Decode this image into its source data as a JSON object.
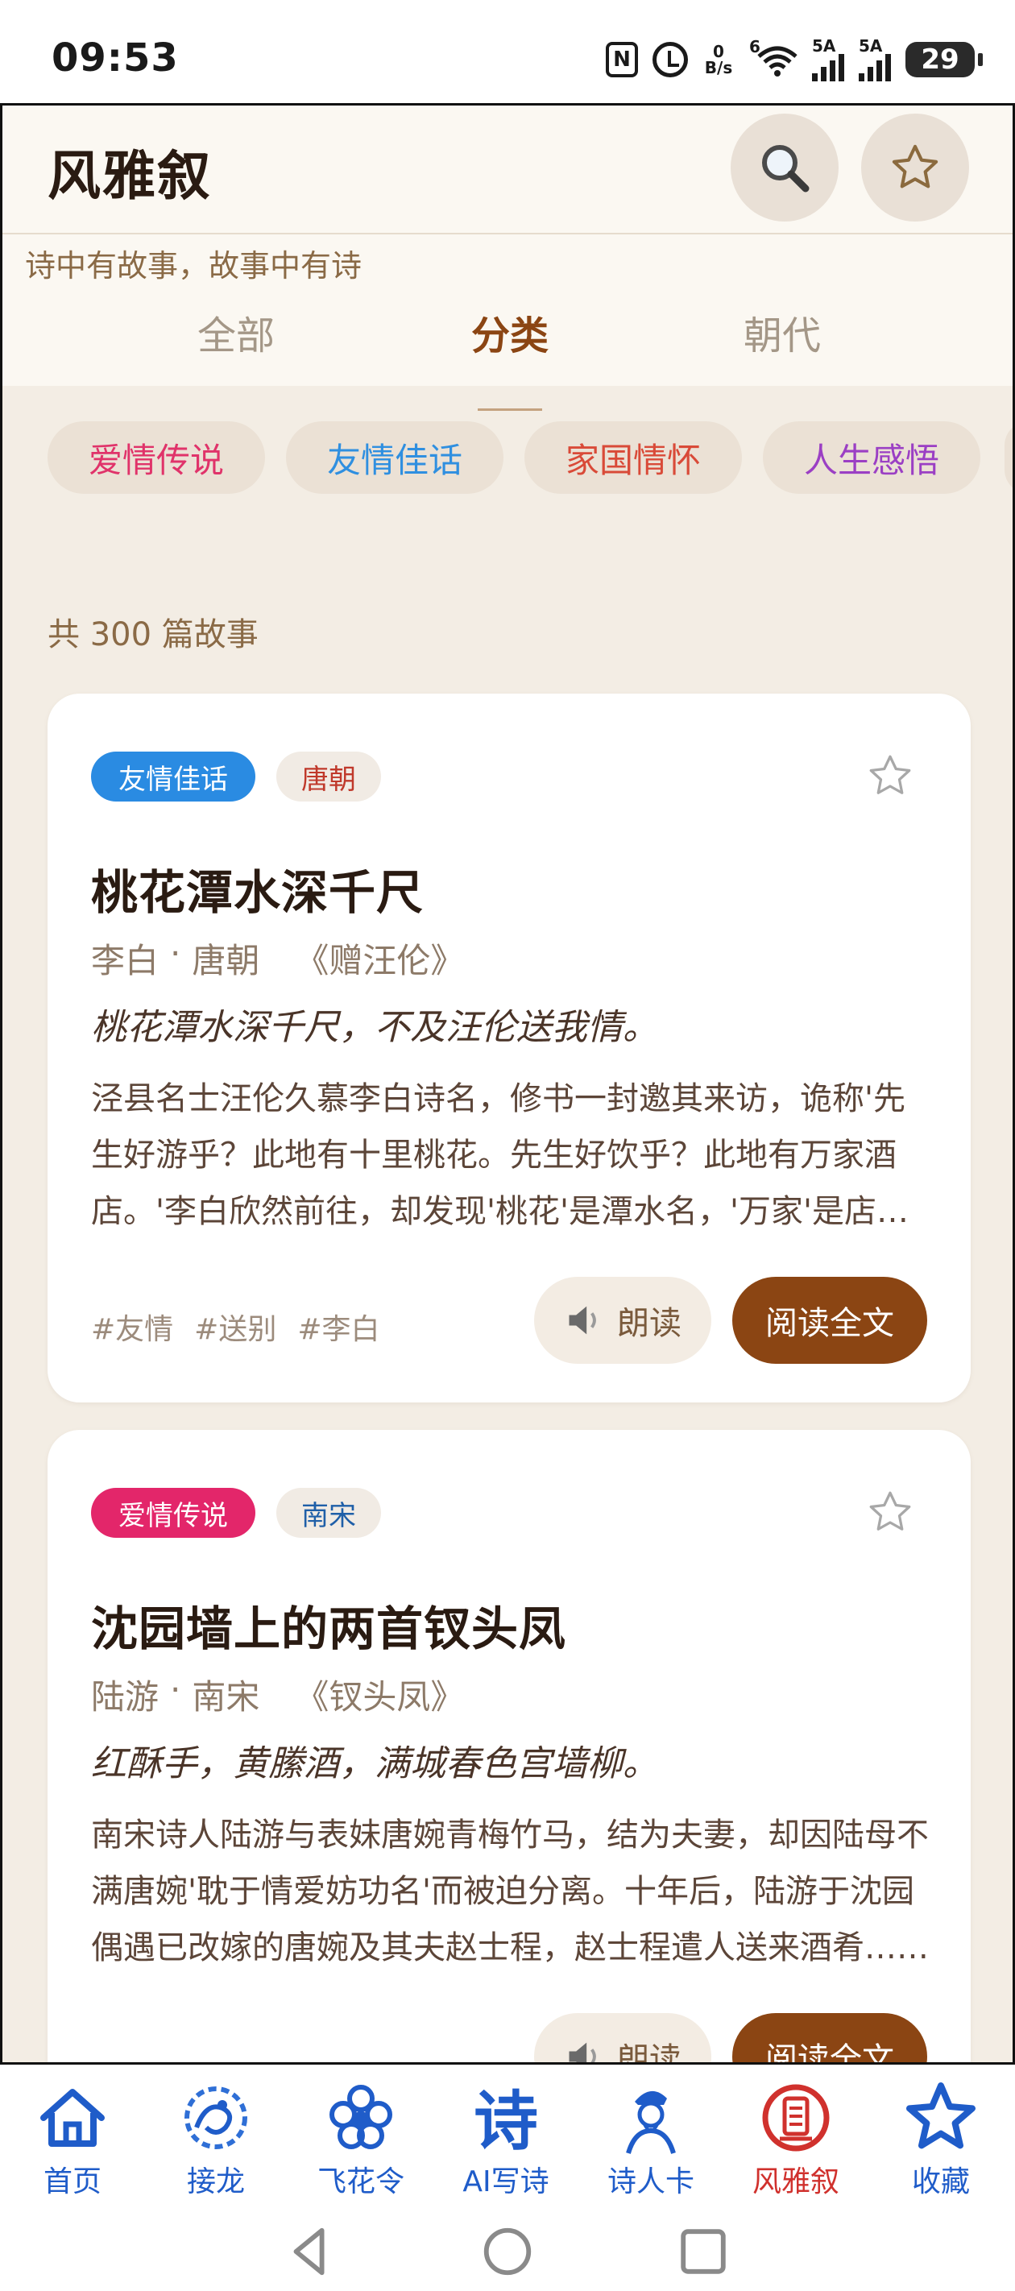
{
  "status_bar": {
    "time": "09:53",
    "net_speed_value": "0",
    "net_speed_unit": "B/s",
    "wifi_label": "6",
    "sim1_label": "5A",
    "sim2_label": "5A",
    "battery": "29"
  },
  "header": {
    "title": "风雅叙",
    "subtitle": "诗中有故事，故事中有诗",
    "search_icon": "search-icon",
    "favorite_icon": "star-outline-icon"
  },
  "tabs": [
    {
      "label": "全部",
      "active": false
    },
    {
      "label": "分类",
      "active": true
    },
    {
      "label": "朝代",
      "active": false
    }
  ],
  "categories": [
    {
      "label": "爱情传说",
      "color": "#e0336a"
    },
    {
      "label": "友情佳话",
      "color": "#2f8fe0"
    },
    {
      "label": "家国情怀",
      "color": "#d94a38"
    },
    {
      "label": "人生感悟",
      "color": "#9b3fc4"
    }
  ],
  "story_count": "共 300 篇故事",
  "stories": [
    {
      "category": "友情佳话",
      "category_color": "#2a8be2",
      "dynasty": "唐朝",
      "dynasty_color": "#c0392b",
      "title": "桃花潭水深千尺",
      "author": "李白",
      "separator": "·",
      "era": "唐朝",
      "work": "《赠汪伦》",
      "quote": "桃花潭水深千尺，不及汪伦送我情。",
      "excerpt": "泾县名士汪伦久慕李白诗名，修书一封邀其来访，诡称'先生好游乎？此地有十里桃花。先生好饮乎？此地有万家酒店。'李白欣然前往，却发现'桃花'是潭水名，'万家'是店主姓万……",
      "hashtags": [
        "#友情",
        "#送别",
        "#李白"
      ],
      "read_aloud_label": "朗读",
      "read_full_label": "阅读全文"
    },
    {
      "category": "爱情传说",
      "category_color": "#e3266a",
      "dynasty": "南宋",
      "dynasty_color": "#1f5fa8",
      "title": "沈园墙上的两首钗头凤",
      "author": "陆游",
      "separator": "·",
      "era": "南宋",
      "work": "《钗头凤》",
      "quote": "红酥手，黄縢酒，满城春色宫墙柳。",
      "excerpt": "南宋诗人陆游与表妹唐婉青梅竹马，结为夫妻，却因陆母不满唐婉'耽于情爱妨功名'而被迫分离。十年后，陆游于沈园偶遇已改嫁的唐婉及其夫赵士程，赵士程遣人送来酒肴……",
      "hashtags": [],
      "read_aloud_label": "朗读",
      "read_full_label": "阅读全文"
    }
  ],
  "bottom_nav": [
    {
      "label": "首页",
      "icon": "home-icon",
      "active": false
    },
    {
      "label": "接龙",
      "icon": "dragon-icon",
      "active": false
    },
    {
      "label": "飞花令",
      "icon": "flower-icon",
      "active": false
    },
    {
      "label": "AI写诗",
      "icon": "poem-glyph-icon",
      "active": false
    },
    {
      "label": "诗人卡",
      "icon": "poet-portrait-icon",
      "active": false
    },
    {
      "label": "风雅叙",
      "icon": "scroll-seal-icon",
      "active": true
    },
    {
      "label": "收藏",
      "icon": "star-icon",
      "active": false
    }
  ],
  "system_nav": [
    "back-icon",
    "home-circle-icon",
    "recents-icon"
  ],
  "colors": {
    "accent": "#8b4513",
    "nav_blue": "#1f5cc9",
    "nav_active": "#d0312d",
    "background": "#f3ede4"
  }
}
